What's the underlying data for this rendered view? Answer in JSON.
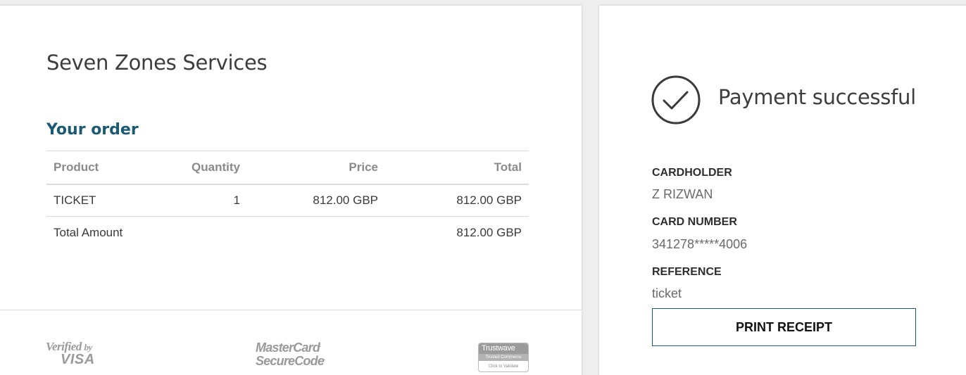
{
  "merchant": {
    "name": "Seven Zones Services"
  },
  "order": {
    "title": "Your order",
    "headers": {
      "product": "Product",
      "quantity": "Quantity",
      "price": "Price",
      "total": "Total"
    },
    "rows": [
      {
        "product": "TICKET",
        "quantity": "1",
        "price": "812.00 GBP",
        "total": "812.00 GBP"
      }
    ],
    "total_label": "Total Amount",
    "total_value": "812.00 GBP"
  },
  "footer": {
    "verified_by": "Verified",
    "verified_by_small": "by",
    "visa": "VISA",
    "mastercard_line1": "MasterCard",
    "mastercard_line2": "SecureCode",
    "trustwave_line1": "Trustwave",
    "trustwave_line2": "Trusted Commerce",
    "trustwave_line3": "Click to Validate"
  },
  "payment": {
    "status": "Payment successful",
    "status_icon": "check-circle-icon",
    "cardholder_label": "CARDHOLDER",
    "cardholder_value": "Z RIZWAN",
    "card_number_label": "CARD NUMBER",
    "card_number_value": "341278*****4006",
    "reference_label": "REFERENCE",
    "reference_value": "ticket",
    "print_button": "PRINT RECEIPT"
  },
  "colors": {
    "accent": "#1a5a73",
    "background": "#eeeeee",
    "panel": "#ffffff"
  }
}
